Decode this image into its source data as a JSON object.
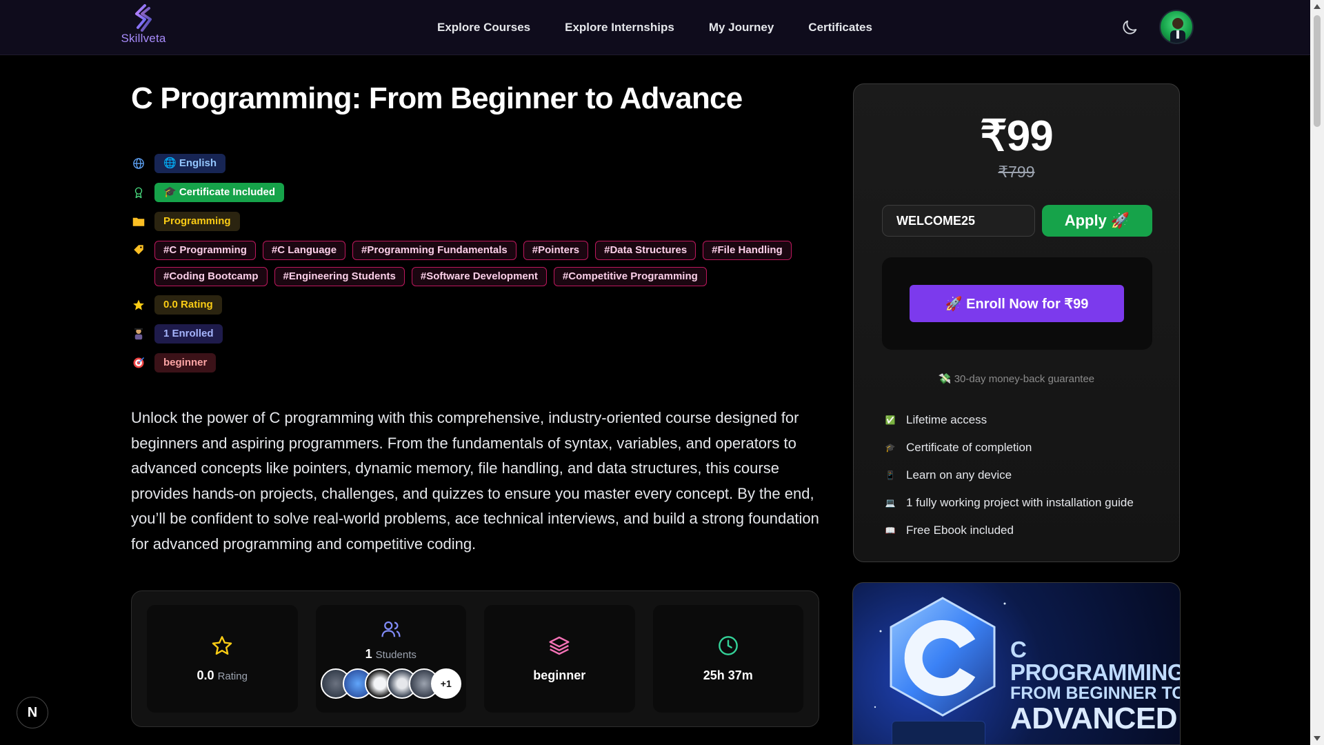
{
  "brand": {
    "name": "Skillveta",
    "color": "#a78bfa"
  },
  "nav": {
    "links": [
      "Explore Courses",
      "Explore Internships",
      "My Journey",
      "Certificates"
    ],
    "theme_icon": "moon-icon"
  },
  "course": {
    "title": "C Programming: From Beginner to Advance",
    "language": "🌐 English",
    "certificate": "🎓 Certificate Included",
    "category": "Programming",
    "tags": [
      "#C Programming",
      "#C Language",
      "#Programming Fundamentals",
      "#Pointers",
      "#Data Structures",
      "#File Handling",
      "#Coding Bootcamp",
      "#Engineering Students",
      "#Software Development",
      "#Competitive Programming"
    ],
    "rating": "0.0 Rating",
    "enrolled": "1 Enrolled",
    "level": "beginner",
    "description": "Unlock the power of C programming with this comprehensive, industry-oriented course designed for beginners and aspiring programmers. From the fundamentals of syntax, variables, and operators to advanced concepts like pointers, dynamic memory, file handling, and data structures, this course provides hands-on projects, challenges, and quizzes to ensure you master every concept. By the end, you’ll be confident to solve real-world problems, ace technical interviews, and build a strong foundation for advanced programming and competitive coding."
  },
  "stats": {
    "rating_value": "0.0",
    "rating_label": "Rating",
    "students_value": "1",
    "students_label": "Students",
    "students_more": "+1",
    "level": "beginner",
    "duration": "25h 37m"
  },
  "pricing": {
    "price": "₹99",
    "old_price": "₹799",
    "coupon_value": "WELCOME25",
    "apply_label": "Apply 🚀",
    "enroll_label": "🚀 Enroll Now for ₹99",
    "guarantee": "💸 30-day money-back guarantee",
    "features": [
      {
        "icon": "✅",
        "label": "Lifetime access"
      },
      {
        "icon": "🎓",
        "label": "Certificate of completion"
      },
      {
        "icon": "📱",
        "label": "Learn on any device"
      },
      {
        "icon": "💻",
        "label": "1 fully working project with installation guide"
      },
      {
        "icon": "📖",
        "label": "Free Ebook included"
      }
    ]
  },
  "thumbnail": {
    "line1": "C PROGRAMMING:",
    "line2": "FROM BEGINNER TO",
    "line3": "ADVANCED"
  },
  "floating_badge": "N",
  "colors": {
    "accent_purple": "#7c3aed",
    "apply_green": "#16a34a",
    "tag_pink": "#be185d"
  }
}
